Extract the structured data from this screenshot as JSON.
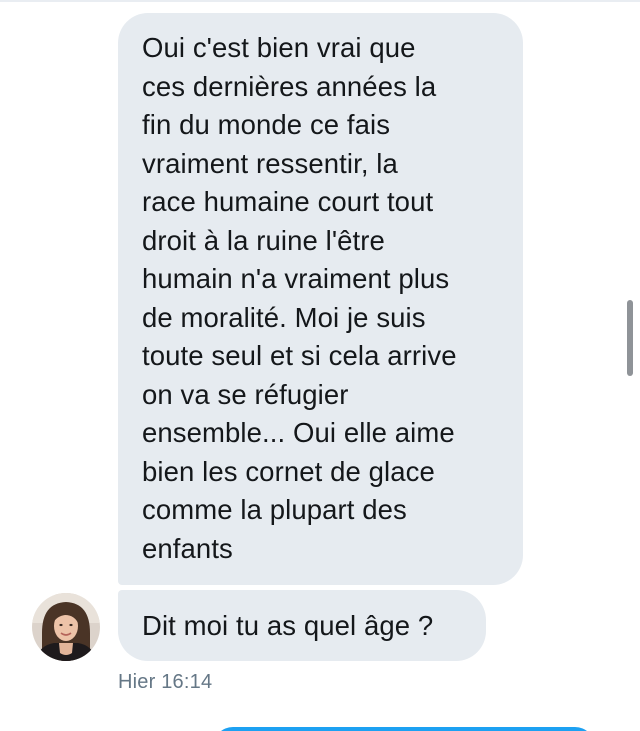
{
  "conversation": {
    "messages": [
      {
        "lines": [
          "Oui c'est bien vrai que",
          "ces dernières années la",
          "fin du monde ce fais",
          "vraiment ressentir, la",
          "race humaine court tout",
          "droit à la ruine l'être",
          "humain n'a vraiment plus",
          "de moralité. Moi je suis",
          "toute seul et si cela arrive",
          "on va se réfugier",
          "ensemble... Oui elle aime",
          "bien les cornet de glace",
          "comme la plupart des",
          "enfants"
        ]
      },
      {
        "text": "Dit moi tu as quel âge ?"
      }
    ],
    "timestamp": "Hier 16:14"
  },
  "colors": {
    "received_bubble": "#e6ebf0",
    "sent_bubble": "#1da1f2",
    "timestamp_text": "#657786",
    "message_text": "#14171a"
  },
  "icons": {
    "avatar": "profile-photo"
  }
}
